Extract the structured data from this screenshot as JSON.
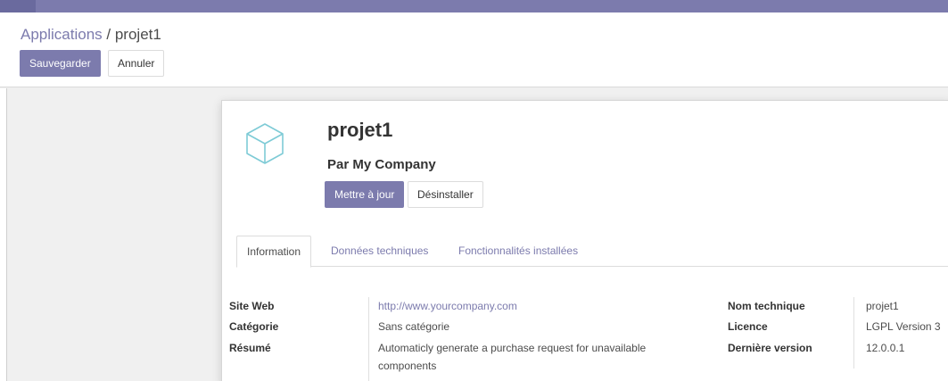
{
  "breadcrumb": {
    "parent": "Applications",
    "separator": " / ",
    "current": "projet1"
  },
  "control_panel": {
    "save_label": "Sauvegarder",
    "discard_label": "Annuler"
  },
  "module": {
    "name": "projet1",
    "author": "Par My Company",
    "upgrade_label": "Mettre à jour",
    "uninstall_label": "Désinstaller",
    "icon": "cube-icon"
  },
  "tabs": [
    {
      "label": "Information",
      "active": true
    },
    {
      "label": "Données techniques",
      "active": false
    },
    {
      "label": "Fonctionnalités installées",
      "active": false
    }
  ],
  "fields_left": [
    {
      "label": "Site Web",
      "value": "http://www.yourcompany.com",
      "is_link": true
    },
    {
      "label": "Catégorie",
      "value": "Sans catégorie",
      "is_link": false
    },
    {
      "label": "Résumé",
      "value": "Automaticly generate a purchase request for unavailable",
      "value_line2": "components",
      "is_link": false
    }
  ],
  "fields_right": [
    {
      "label": "Nom technique",
      "value": "projet1"
    },
    {
      "label": "Licence",
      "value": "LGPL Version 3"
    },
    {
      "label": "Dernière version",
      "value": "12.0.0.1"
    }
  ],
  "colors": {
    "brand": "#7c7bad",
    "topbar": "#7c7bad",
    "link": "#7c7bad"
  }
}
